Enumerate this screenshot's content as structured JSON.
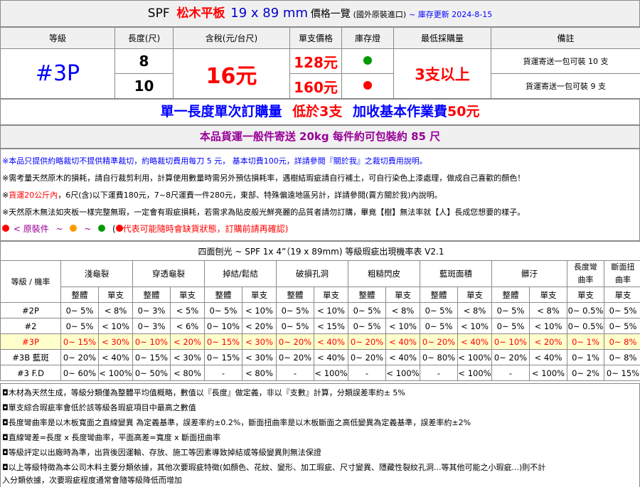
{
  "header": {
    "spf": "SPF",
    "name": "松木平板",
    "size": "19 x 89 mm",
    "suffix": "價格一覽",
    "origin": "(國外原裝進口)",
    "updated": "~ 庫存更新 2024-8-15"
  },
  "price_table": {
    "headers": [
      "等級",
      "長度(尺)",
      "含稅(元/台尺)",
      "單支價格",
      "庫存燈",
      "最低採購量",
      "備註"
    ],
    "grade": "#3P",
    "tax_price": "16元",
    "min_purchase": "3支以上",
    "rows": [
      {
        "length": "8",
        "unit_price": "128元",
        "stock_color": "#009900",
        "remark": "貨運寄送一包可裝 10 支"
      },
      {
        "length": "10",
        "unit_price": "160元",
        "stock_color": "#ff0000",
        "remark": "貨運寄送一包可裝 9 支"
      }
    ]
  },
  "banner1": {
    "part1": "單一長度單次訂購量",
    "part2": "低於3支",
    "part3": "加收基本作業費",
    "part4": "50元"
  },
  "banner2": "本品貨運一般件寄送 20kg 每件約可包裝約 85 尺",
  "notes": [
    {
      "prefix": "※本品只提供約略裁切不提供精準裁切，約略裁切費用每刀 5 元， 基本切費100元，詳請參閱『關於我』之裁切費用說明。"
    },
    {
      "prefix": "※需考量天然原木的損耗，請自行裁剪利用，計算使用數量時需另外預估損耗率，遇樹結瑕疵請自行補土，可自行染色上漆處理，做成自己喜歡的顏色！"
    },
    {
      "prefix": "※",
      "red": "貨運20公斤內",
      "rest": "，6尺(含)以下運費180元，7~8尺運費一件280元，東部、特殊偏遠地區另計，詳請參閱(賣方關於我)內說明。"
    },
    {
      "prefix": "※天然原木無法如夾板一樣完整無瑕，一定會有瑕疵損耗，若需求為貼皮般光鮮亮麗的品質者請勿訂購，畢竟【樹】無法率就【人】長成您想要的樣子。"
    }
  ],
  "legend": {
    "label": "< 原裝件",
    "tilde": "~",
    "colors": [
      "#ff0000",
      "#ff9900",
      "#009900"
    ],
    "warn_pre": "(",
    "warn_text": "代表可能隨時會缺貨狀態，訂購前請再確認)"
  },
  "defect_table": {
    "title": "四面刨光 ~ SPF 1x 4”（19 x 89mm) 等級瑕疵出現機率表 V2.1",
    "grade_header": "等級 / 機率",
    "groups": [
      "淺龜裂",
      "穿透龜裂",
      "掉結/鬆結",
      "破損孔洞",
      "粗糙閃皮",
      "藍斑面積",
      "髒汙"
    ],
    "single_groups": [
      "長度彎曲率",
      "斷面扭曲率"
    ],
    "sub": [
      "整體",
      "單支"
    ],
    "rows": [
      {
        "grade": "#2P",
        "vals": [
          "0~ 5%",
          "< 8%",
          "0~ 3%",
          "< 5%",
          "0~ 5%",
          "< 10%",
          "0~ 5%",
          "< 10%",
          "0~ 5%",
          "< 8%",
          "0~ 5%",
          "< 8%",
          "0~ 5%",
          "< 8%",
          "0~ 0.5%",
          "0~ 5%"
        ]
      },
      {
        "grade": "#2",
        "vals": [
          "0~ 5%",
          "< 10%",
          "0~ 3%",
          "< 6%",
          "0~ 10%",
          "< 20%",
          "0~ 5%",
          "< 15%",
          "0~ 5%",
          "< 10%",
          "0~ 5%",
          "< 10%",
          "0~ 5%",
          "< 10%",
          "0~ 0.5%",
          "0~ 5%"
        ]
      },
      {
        "grade": "#3P",
        "highlight": true,
        "vals": [
          "0~ 15%",
          "< 30%",
          "0~ 10%",
          "< 20%",
          "0~ 15%",
          "< 30%",
          "0~ 20%",
          "< 40%",
          "0~ 20%",
          "< 40%",
          "0~ 20%",
          "< 40%",
          "0~ 10%",
          "< 20%",
          "0~ 1%",
          "0~ 8%"
        ]
      },
      {
        "grade": "#3B 藍斑",
        "vals": [
          "0~ 20%",
          "< 40%",
          "0~ 15%",
          "< 30%",
          "0~ 15%",
          "< 30%",
          "0~ 20%",
          "< 40%",
          "0~ 20%",
          "< 40%",
          "0~ 80%",
          "< 100%",
          "0~ 20%",
          "< 40%",
          "0~ 1%",
          "0~ 8%"
        ]
      },
      {
        "grade": "#3 F.D",
        "vals": [
          "0~ 60%",
          "< 100%",
          "0~ 50%",
          "< 80%",
          "-",
          "< 80%",
          "-",
          "< 100%",
          "-",
          "< 100%",
          "-",
          "< 100%",
          "-",
          "< 100%",
          "0~ 2%",
          "0~ 15%"
        ]
      }
    ]
  },
  "footnotes": [
    "◘木材為天然生成，等級分類僅為整體平均值概略，數值以『長度』做定義，非以『支數』計算，分類誤差率約± 5%",
    "◘單支綜合瑕疵率會低於該等級各瑕疵項目中最高之數值",
    "◘長度彎曲率是以木板寬面之直線變異 為定義基準，誤差率約±0.2%，斷面扭曲率是以木板斷面之高低變異為定義基準，誤差率約±2%",
    "◘直線彎差=長度 x 長度彎曲率，平面高差=寬度 x 斷面扭曲率",
    "◘等級評定以出廠時為準，出貨後因運輸、存放、施工等因素導致掉結或等級變異則無法保證",
    "◘以上等級特徵為本公司木料主要分類依據，其他次要瑕疵特徵(如顏色、花紋、變形、加工瑕疵、尺寸變異、隱藏性裂紋孔洞...等其他可能之小瑕疵...)則不計",
    "入分類依據，次要瑕疵程度通常會隨等級降低而增加"
  ]
}
